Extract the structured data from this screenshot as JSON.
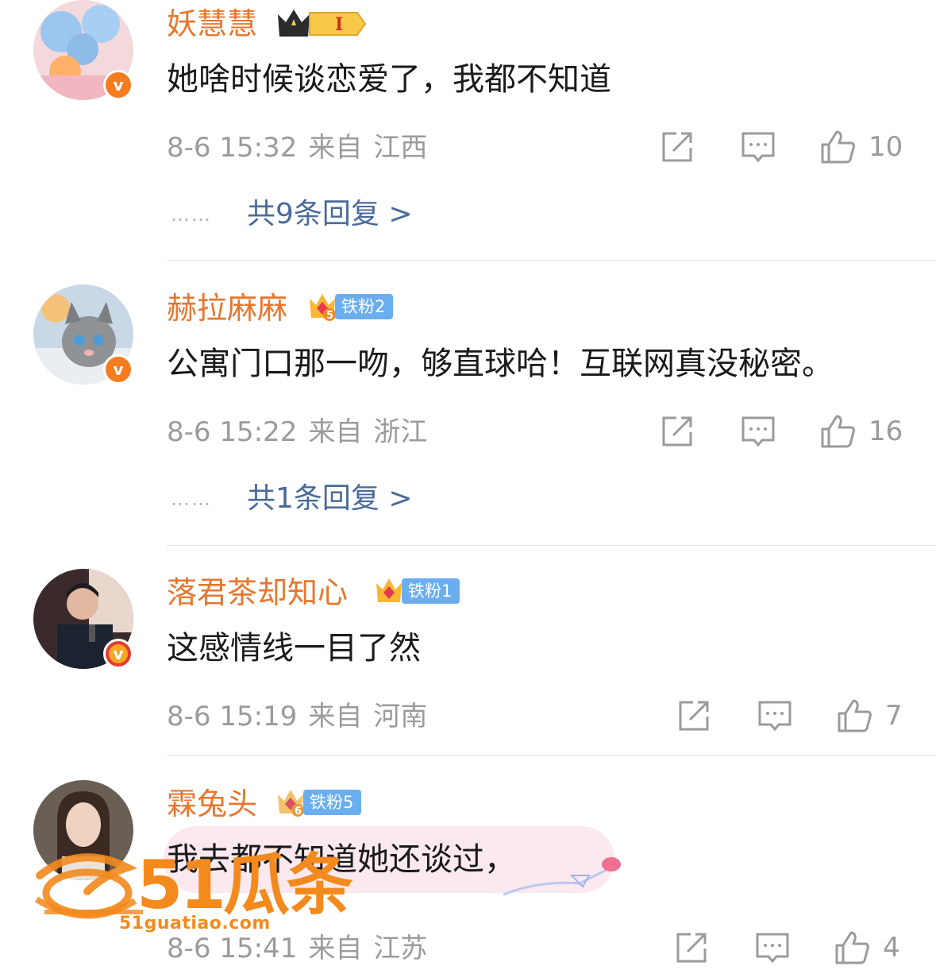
{
  "comments": [
    {
      "username": "妖慧慧",
      "badge_text": "I",
      "text": "她啥时候谈恋爱了，我都不知道",
      "time": "8-6 15:32",
      "from": "来自",
      "location": "江西",
      "likes": "10",
      "replies": "共9条回复 >"
    },
    {
      "username": "赫拉麻麻",
      "badge_text": "铁粉2",
      "badge_level": "5",
      "text": "公寓门口那一吻，够直球哈！互联网真没秘密。",
      "time": "8-6 15:22",
      "from": "来自",
      "location": "浙江",
      "likes": "16",
      "replies": "共1条回复 >"
    },
    {
      "username": "落君茶却知心",
      "badge_text": "铁粉1",
      "text": "这感情线一目了然",
      "time": "8-6 15:19",
      "from": "来自",
      "location": "河南",
      "likes": "7"
    },
    {
      "username": "霖兔头",
      "badge_text": "铁粉5",
      "badge_level": "6",
      "text": "我去都不知道她还谈过，",
      "time": "8-6 15:41",
      "from": "来自",
      "location": "江苏",
      "likes": "4"
    }
  ],
  "reply_dots": "……",
  "vip_mark": "v",
  "watermark": {
    "logo": "51瓜条",
    "site": "51guatiao.com"
  },
  "colors": {
    "username": "#e8762d",
    "reply_link": "#4a6b9a",
    "meta": "#9b9b9b",
    "fan_badge": "#6aaef0",
    "vip": "#f57c1f"
  }
}
